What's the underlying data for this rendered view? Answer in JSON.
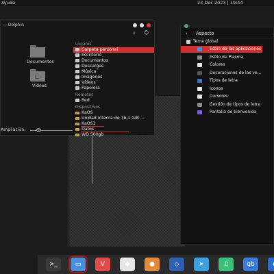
{
  "topbar": {
    "menu": "Ayuda",
    "clock": "23 Dec 2023 | 19:44"
  },
  "dolphin": {
    "title": "— Dolphin",
    "folders": [
      {
        "label": "Documentos"
      },
      {
        "label": "Vídeos"
      }
    ],
    "sections": {
      "places": "Lugares",
      "remote": "Remotos",
      "devices": "Dispositivos"
    },
    "places": [
      "Carpeta personal",
      "Escritorio",
      "Documentos",
      "Descargas",
      "Música",
      "Imágenes",
      "Vídeos",
      "Papelera"
    ],
    "remote": [
      "Red"
    ],
    "devices": [
      "KaOS",
      "Unidad interna de 76,1 GiB ...",
      "KaOS1",
      "Datos",
      "WD 500gb"
    ],
    "zoom_label": "Ampliación:",
    "zoom_level": 0.2
  },
  "settings": {
    "back": "‹",
    "title": "Aspecto",
    "group": "Tema global",
    "items": [
      {
        "label": "Estilo de las aplicaciones",
        "color": "#4a8fd8"
      },
      {
        "label": "Estilo de Plasma",
        "color": "#8a8a8a"
      },
      {
        "label": "Colores",
        "color": "#e6e6e6"
      },
      {
        "label": "Decoraciones de las ve...",
        "color": "#555555"
      },
      {
        "label": "Tipos de letra",
        "color": "#3f6fb5"
      },
      {
        "label": "Iconos",
        "color": "#e6e6e6"
      },
      {
        "label": "Cursores",
        "color": "#e6e6e6"
      },
      {
        "label": "Gestión de tipos de letra",
        "color": "#8a8a8a"
      },
      {
        "label": "Pantalla de bienvenida",
        "color": "#7b5bd6"
      }
    ]
  },
  "dock": [
    {
      "name": "terminal-icon",
      "glyph": ">_",
      "color": "#3a3a3a"
    },
    {
      "name": "file-manager-icon",
      "glyph": "▭",
      "color": "#4a8fd8",
      "active": true
    },
    {
      "name": "vivaldi-icon",
      "glyph": "V",
      "color": "#e04a4a"
    },
    {
      "name": "inkscape-icon",
      "glyph": "◆",
      "color": "#e6e6e6"
    },
    {
      "name": "image-viewer-icon",
      "glyph": "●",
      "color": "#e08a3a"
    },
    {
      "name": "kaos-icon",
      "glyph": "◇",
      "color": "#2e5fb0"
    },
    {
      "name": "telegram-icon",
      "glyph": "➤",
      "color": "#3aa0e0"
    },
    {
      "name": "music-icon",
      "glyph": "♫",
      "color": "#3ac07a"
    },
    {
      "name": "qbittorrent-icon",
      "glyph": "qb",
      "color": "#3a7ad8"
    },
    {
      "name": "app-icon",
      "glyph": "◐",
      "color": "#2a6ad0"
    }
  ]
}
